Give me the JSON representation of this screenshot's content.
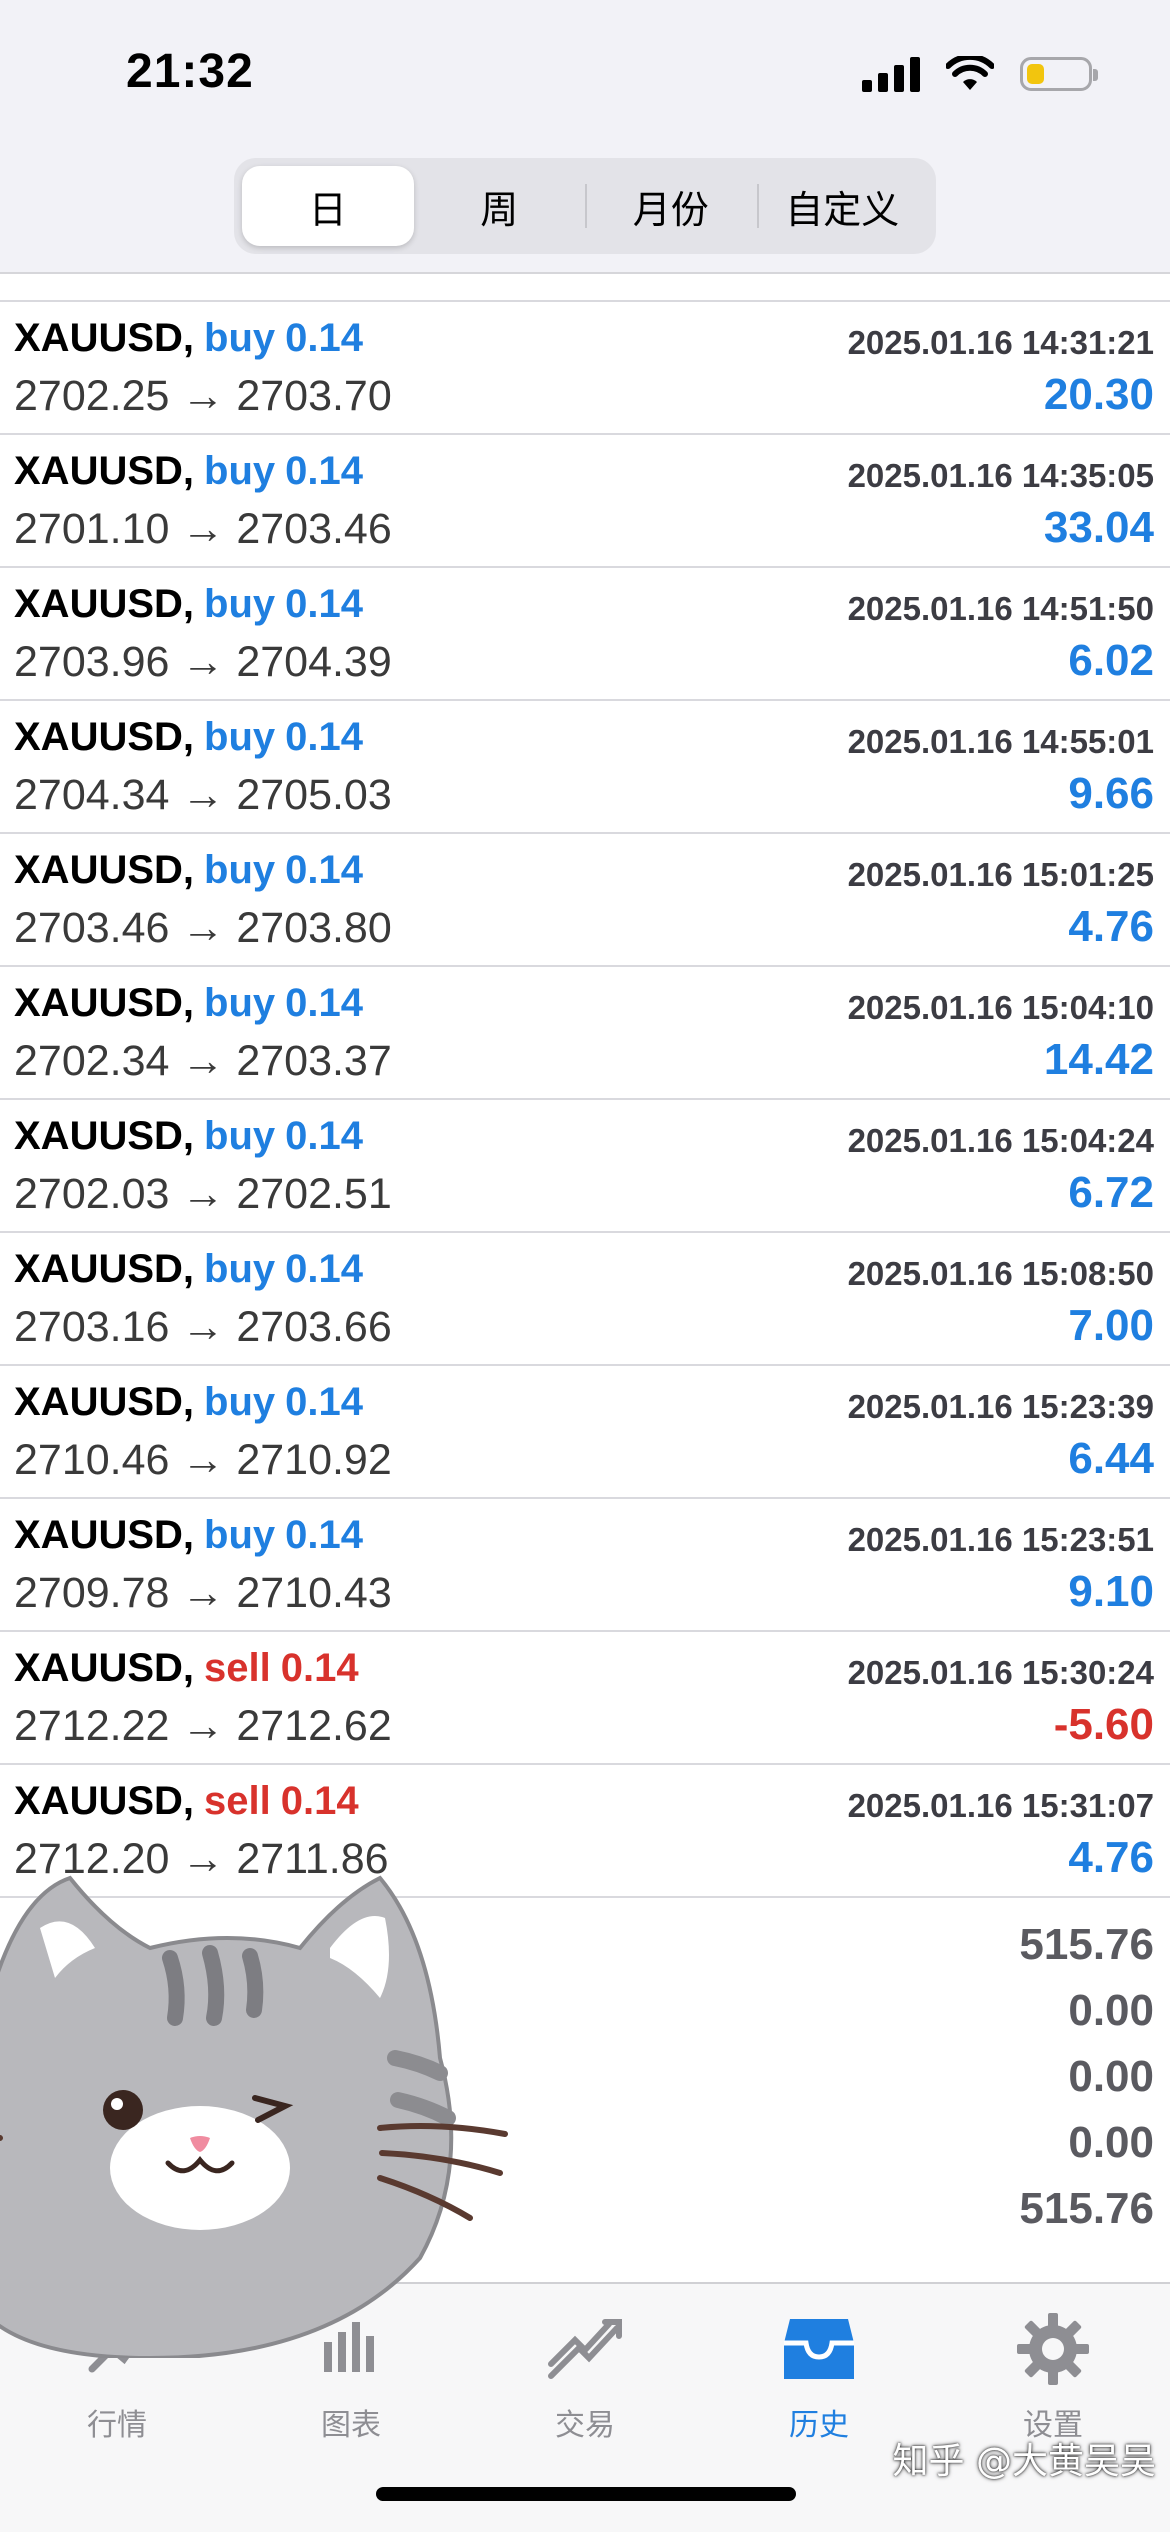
{
  "status_bar": {
    "time": "21:32",
    "icons": [
      "cellular-signal-icon",
      "wifi-icon",
      "battery-icon"
    ],
    "battery_level": 0.3
  },
  "period_tabs": {
    "items": [
      "日",
      "周",
      "月份",
      "自定义"
    ],
    "active_index": 0
  },
  "colors": {
    "buy": "#1f7fe0",
    "sell": "#d8322c",
    "positive": "#1f7fe0",
    "negative": "#d8322c",
    "accent": "#1f7fe0"
  },
  "trades": [
    {
      "symbol": "XAUUSD,",
      "side": "buy",
      "volume": "0.14",
      "time": "2025.01.16 14:31:21",
      "prices": "2702.25 → 2703.70",
      "profit": "20.30"
    },
    {
      "symbol": "XAUUSD,",
      "side": "buy",
      "volume": "0.14",
      "time": "2025.01.16 14:35:05",
      "prices": "2701.10 → 2703.46",
      "profit": "33.04"
    },
    {
      "symbol": "XAUUSD,",
      "side": "buy",
      "volume": "0.14",
      "time": "2025.01.16 14:51:50",
      "prices": "2703.96 → 2704.39",
      "profit": "6.02"
    },
    {
      "symbol": "XAUUSD,",
      "side": "buy",
      "volume": "0.14",
      "time": "2025.01.16 14:55:01",
      "prices": "2704.34 → 2705.03",
      "profit": "9.66"
    },
    {
      "symbol": "XAUUSD,",
      "side": "buy",
      "volume": "0.14",
      "time": "2025.01.16 15:01:25",
      "prices": "2703.46 → 2703.80",
      "profit": "4.76"
    },
    {
      "symbol": "XAUUSD,",
      "side": "buy",
      "volume": "0.14",
      "time": "2025.01.16 15:04:10",
      "prices": "2702.34 → 2703.37",
      "profit": "14.42"
    },
    {
      "symbol": "XAUUSD,",
      "side": "buy",
      "volume": "0.14",
      "time": "2025.01.16 15:04:24",
      "prices": "2702.03 → 2702.51",
      "profit": "6.72"
    },
    {
      "symbol": "XAUUSD,",
      "side": "buy",
      "volume": "0.14",
      "time": "2025.01.16 15:08:50",
      "prices": "2703.16 → 2703.66",
      "profit": "7.00"
    },
    {
      "symbol": "XAUUSD,",
      "side": "buy",
      "volume": "0.14",
      "time": "2025.01.16 15:23:39",
      "prices": "2710.46 → 2710.92",
      "profit": "6.44"
    },
    {
      "symbol": "XAUUSD,",
      "side": "buy",
      "volume": "0.14",
      "time": "2025.01.16 15:23:51",
      "prices": "2709.78 → 2710.43",
      "profit": "9.10"
    },
    {
      "symbol": "XAUUSD,",
      "side": "sell",
      "volume": "0.14",
      "time": "2025.01.16 15:30:24",
      "prices": "2712.22 → 2712.62",
      "profit": "-5.60"
    },
    {
      "symbol": "XAUUSD,",
      "side": "sell",
      "volume": "0.14",
      "time": "2025.01.16 15:31:07",
      "prices": "2712.20 → 2711.86",
      "profit": "4.76"
    }
  ],
  "summary": {
    "values": [
      "515.76",
      "0.00",
      "0.00",
      "0.00",
      "515.76"
    ]
  },
  "tab_bar": {
    "items": [
      {
        "label": "行情",
        "icon": "quotes-icon"
      },
      {
        "label": "图表",
        "icon": "chart-icon"
      },
      {
        "label": "交易",
        "icon": "trade-icon"
      },
      {
        "label": "历史",
        "icon": "history-icon"
      },
      {
        "label": "设置",
        "icon": "gear-icon"
      }
    ],
    "active_index": 3
  },
  "watermark": "知乎 @大黄吴吴",
  "sticker": {
    "icon": "cat-sticker-icon"
  }
}
